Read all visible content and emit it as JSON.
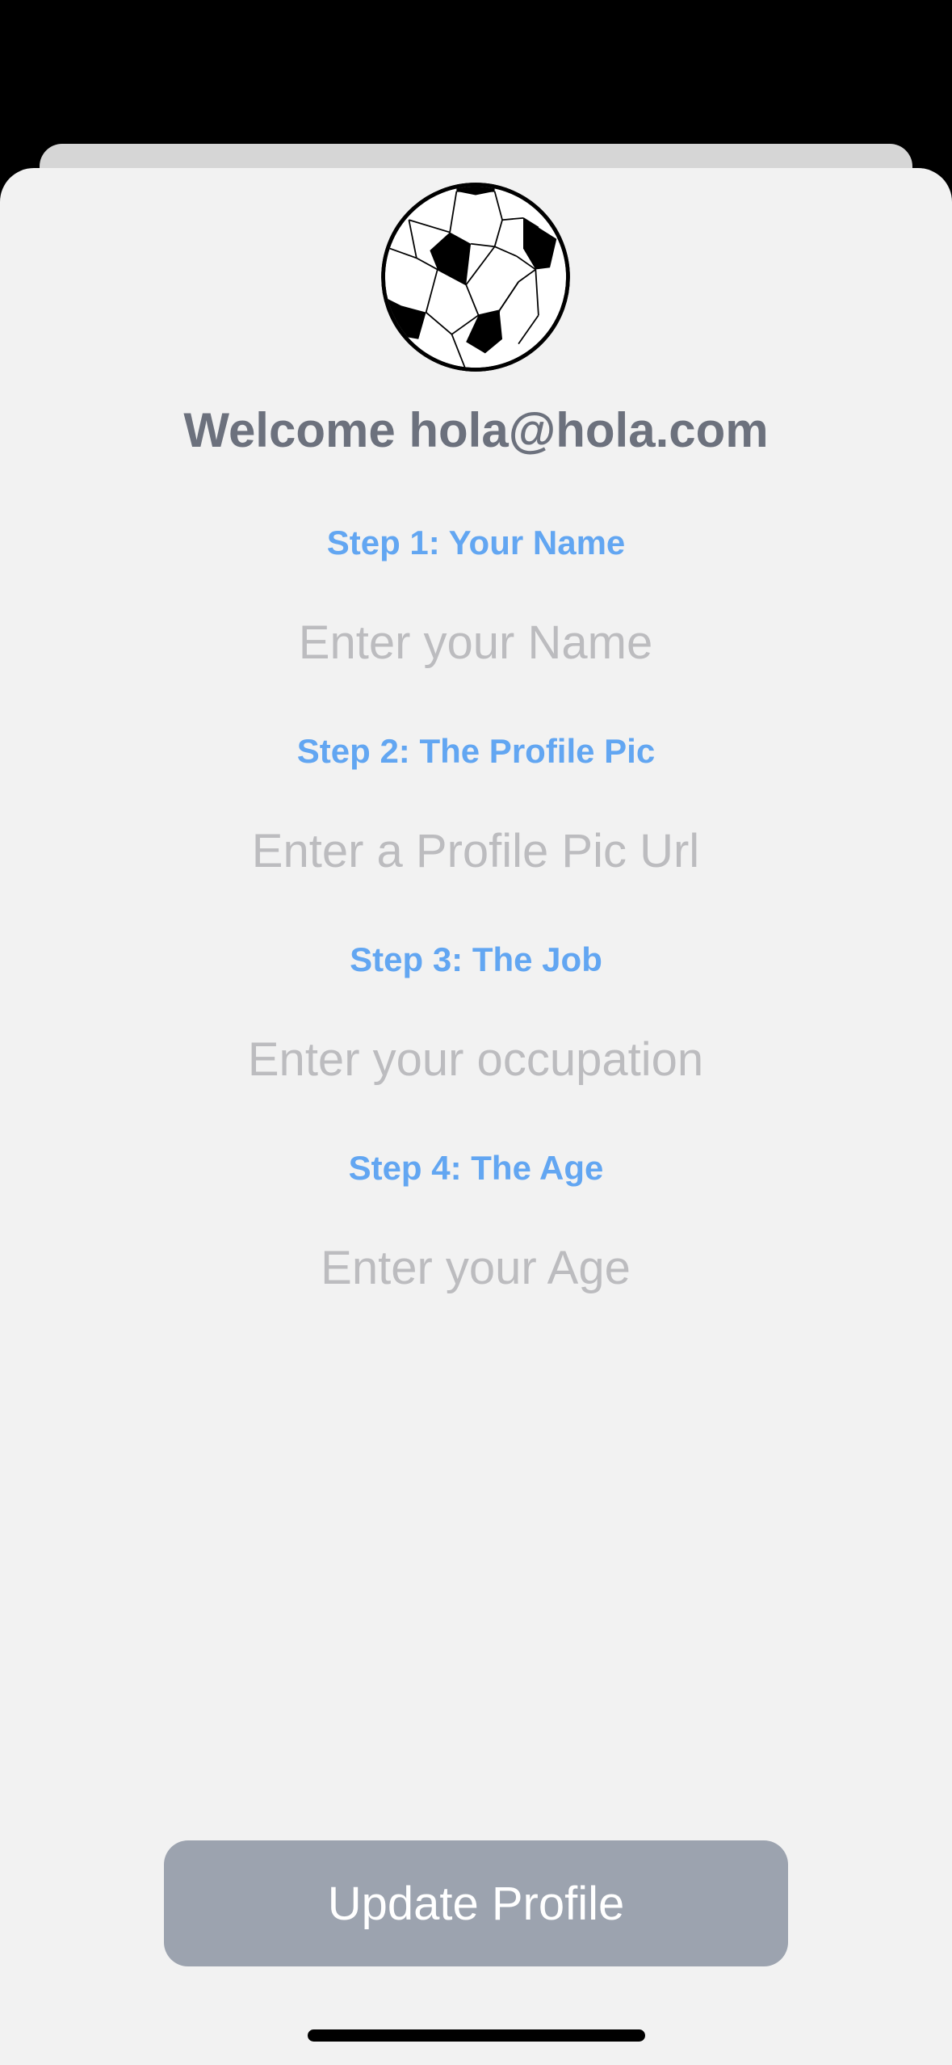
{
  "header": {
    "welcome_text": "Welcome hola@hola.com",
    "logo_icon": "soccer-ball-icon"
  },
  "steps": [
    {
      "label": "Step 1: Your Name",
      "placeholder": "Enter your Name",
      "value": ""
    },
    {
      "label": "Step 2: The Profile Pic",
      "placeholder": "Enter a Profile Pic Url",
      "value": ""
    },
    {
      "label": "Step 3: The Job",
      "placeholder": "Enter your occupation",
      "value": ""
    },
    {
      "label": "Step 4: The Age",
      "placeholder": "Enter your Age",
      "value": ""
    }
  ],
  "actions": {
    "update_label": "Update Profile"
  },
  "colors": {
    "background": "#000000",
    "sheet": "#f2f2f2",
    "step_label": "#62a6f2",
    "welcome_text": "#6c717d",
    "placeholder": "#bcbcbf",
    "button": "#9ca3af",
    "button_text": "#ffffff"
  }
}
